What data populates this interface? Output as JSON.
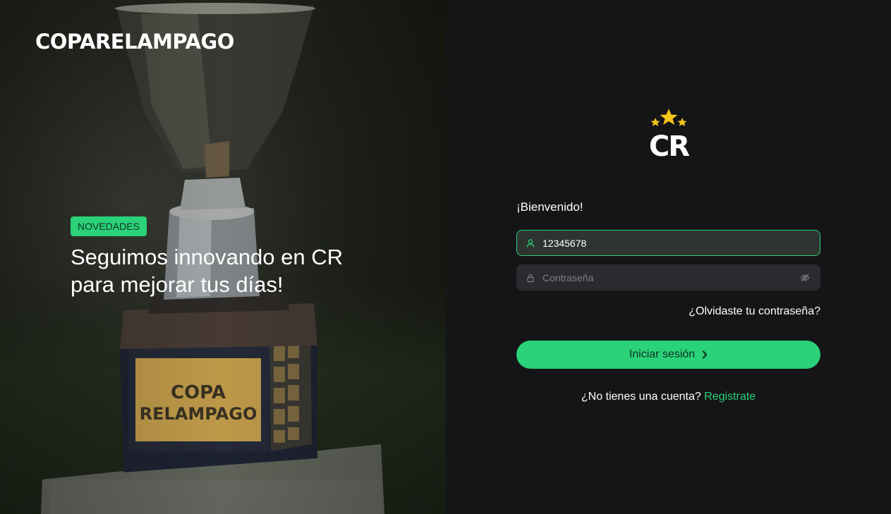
{
  "brand": "COPARELAMPAGO",
  "hero": {
    "badge": "NOVEDADES",
    "title": "Seguimos innovando en CR para mejorar tus días!",
    "plaque_line1": "COPA",
    "plaque_line2": "RELAMPAGO"
  },
  "logo": {
    "text": "CR"
  },
  "login": {
    "welcome": "¡Bienvenido!",
    "user_value": "12345678",
    "password_placeholder": "Contraseña",
    "forgot_label": "¿Olvidaste tu contraseña?",
    "submit_label": "Iniciar sesión",
    "signup_prompt": "¿No tienes una cuenta?",
    "signup_link": "Registrate"
  },
  "colors": {
    "accent": "#2ad27a",
    "background": "#151517",
    "field_bg": "#2b2b2f",
    "star": "#f5c518"
  },
  "icons": {
    "user": "user-icon",
    "lock": "lock-icon",
    "eye_off": "eye-off-icon",
    "chevron": "chevron-right-icon",
    "star": "star-icon"
  }
}
